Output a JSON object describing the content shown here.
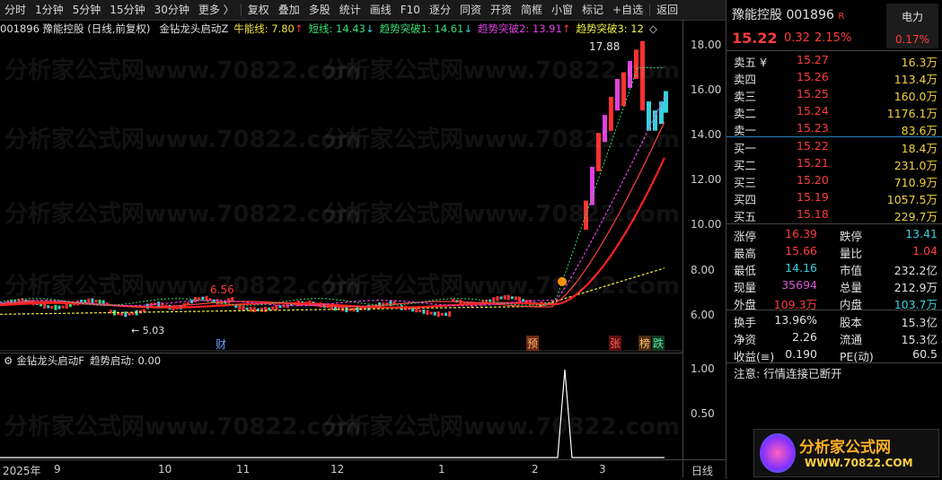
{
  "toolbar": [
    "分时",
    "1分钟",
    "5分钟",
    "15分钟",
    "30分钟",
    "更多 〉",
    "复权",
    "叠加",
    "多股",
    "统计",
    "画线",
    "F10",
    "逐分",
    "同资",
    "开资",
    "简框",
    "小窗",
    "标记",
    "+自选",
    "返回"
  ],
  "indicator": {
    "code_name": "001896 豫能控股 (日线,前复权)",
    "formula": "金钻龙头启动Z",
    "niu_label": "牛能线: 7.80",
    "niu_arrow": "↑",
    "short_label": "短线: 14.43",
    "short_arrow": "↓",
    "trend1_label": "趋势突破1: 14.61",
    "trend1_arrow": "↓",
    "trend2_label": "趋势突破2: 13.91",
    "trend2_arrow": "↑",
    "trend3_label": "趋势突破3: 12",
    "trend3_tail": "◇"
  },
  "yaxis": [
    "18.00",
    "16.00",
    "14.00",
    "12.00",
    "10.00",
    "8.00",
    "6.00"
  ],
  "sub_yaxis": [
    "1.00",
    "0.50"
  ],
  "sub_indicator": {
    "name": "金钻龙头启动F",
    "value_label": "趋势启动: 0.00"
  },
  "chart_annotations": {
    "high": "17.88",
    "mid_high": "6.56",
    "low": "← 5.03"
  },
  "event_badges": [
    "财",
    "预",
    "张",
    "榜",
    "跌"
  ],
  "xaxis": {
    "labels": [
      "2025年",
      "9",
      "10",
      "11",
      "12",
      "1",
      "2",
      "3"
    ],
    "period": "日线"
  },
  "watermark": "分析家公式网www.70822.com",
  "quote": {
    "name": "豫能控股",
    "code": "001896",
    "flag": "R",
    "sector": "电力",
    "price": "15.22",
    "change": "0.32",
    "pct": "2.15%",
    "sector_pct": "0.17%",
    "asks": [
      {
        "label": "卖五 ¥",
        "price": "15.27",
        "vol": "16.3万"
      },
      {
        "label": "卖四",
        "price": "15.26",
        "vol": "113.4万"
      },
      {
        "label": "卖三",
        "price": "15.25",
        "vol": "160.0万"
      },
      {
        "label": "卖二",
        "price": "15.24",
        "vol": "1176.1万"
      },
      {
        "label": "卖一",
        "price": "15.23",
        "vol": "83.6万"
      }
    ],
    "bids": [
      {
        "label": "买一",
        "price": "15.22",
        "vol": "18.4万"
      },
      {
        "label": "买二",
        "price": "15.21",
        "vol": "231.0万"
      },
      {
        "label": "买三",
        "price": "15.20",
        "vol": "710.9万"
      },
      {
        "label": "买四",
        "price": "15.19",
        "vol": "1057.5万"
      },
      {
        "label": "买五",
        "price": "15.18",
        "vol": "229.7万"
      }
    ],
    "stats": [
      [
        {
          "k": "涨停",
          "v": "16.39",
          "c": "red"
        },
        {
          "k": "跌停",
          "v": "13.41",
          "c": "grn"
        }
      ],
      [
        {
          "k": "最高",
          "v": "15.66",
          "c": "red"
        },
        {
          "k": "量比",
          "v": "1.04",
          "c": "red"
        }
      ],
      [
        {
          "k": "最低",
          "v": "14.16",
          "c": "grn"
        },
        {
          "k": "市值",
          "v": "232.2亿",
          "c": "wht"
        }
      ],
      [
        {
          "k": "现量",
          "v": "35694",
          "c": "mag"
        },
        {
          "k": "总量",
          "v": "212.9万",
          "c": "wht"
        }
      ],
      [
        {
          "k": "外盘",
          "v": "109.3万",
          "c": "red"
        },
        {
          "k": "内盘",
          "v": "103.7万",
          "c": "grn"
        }
      ]
    ],
    "stats2": [
      [
        {
          "k": "换手",
          "v": "13.96%"
        },
        {
          "k": "股本",
          "v": "15.3亿"
        }
      ],
      [
        {
          "k": "净资",
          "v": "2.26"
        },
        {
          "k": "流通",
          "v": "15.3亿"
        }
      ],
      [
        {
          "k": "收益(≡)",
          "v": "0.190"
        },
        {
          "k": "PE(动)",
          "v": "60.5"
        }
      ]
    ],
    "notice": "注意: 行情连接已断开"
  },
  "logo": {
    "text": "分析家公式网",
    "url": "WWW.70822.COM"
  }
}
